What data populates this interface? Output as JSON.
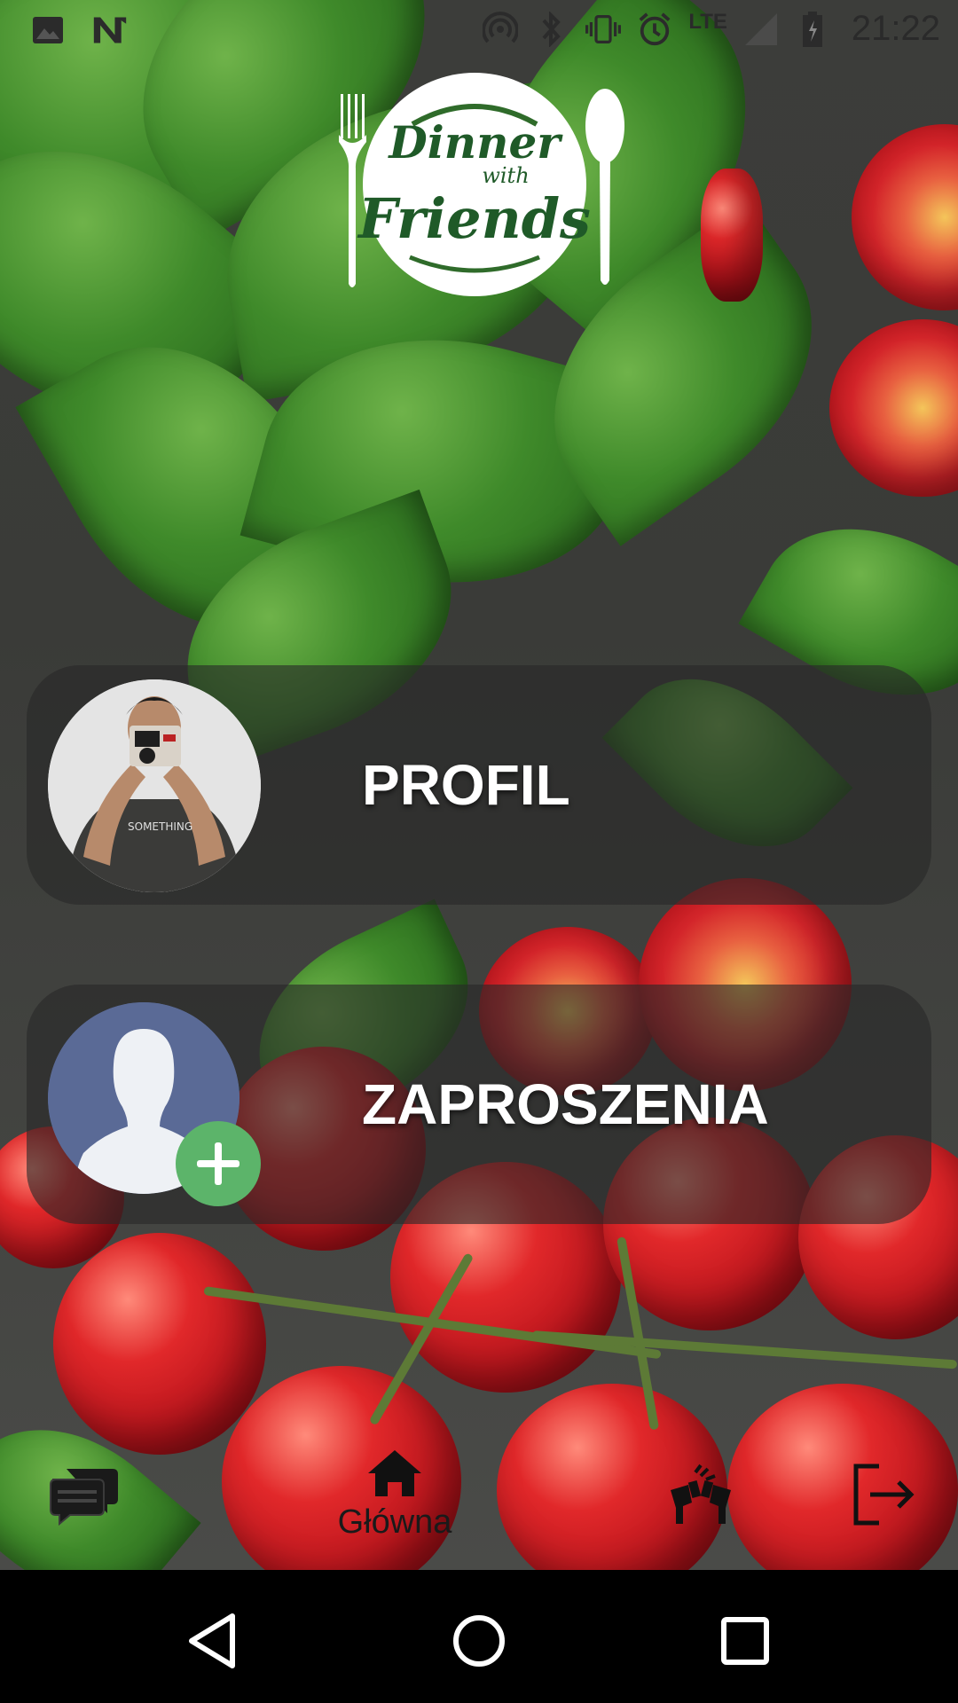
{
  "status_bar": {
    "time": "21:22",
    "network": "LTE",
    "left_icons": [
      "image-icon",
      "n-notification-icon"
    ],
    "right_icons": [
      "hotspot-icon",
      "bluetooth-icon",
      "vibrate-icon",
      "alarm-icon",
      "lte-icon",
      "signal-icon",
      "battery-icon"
    ]
  },
  "header": {
    "logo_text": "Dinner with Friends"
  },
  "cards": {
    "profile": {
      "label": "PROFIL",
      "avatar": "user-photo"
    },
    "invitations": {
      "label": "ZAPROSZENIA",
      "avatar": "default-avatar-with-plus"
    }
  },
  "bottom_nav": {
    "items": [
      {
        "icon": "chat-icon",
        "label": ""
      },
      {
        "icon": "home-icon",
        "label": "Główna",
        "active": true
      },
      {
        "icon": "cheers-icon",
        "label": ""
      },
      {
        "icon": "logout-icon",
        "label": ""
      }
    ]
  },
  "system_nav": {
    "buttons": [
      "back-icon",
      "home-circle-icon",
      "recents-icon"
    ]
  },
  "colors": {
    "card_bg": "#282828",
    "card_text": "#ffffff",
    "badge_green": "#5cb46a",
    "default_avatar": "#5a6a96",
    "nav_text": "#1a1a1a"
  }
}
